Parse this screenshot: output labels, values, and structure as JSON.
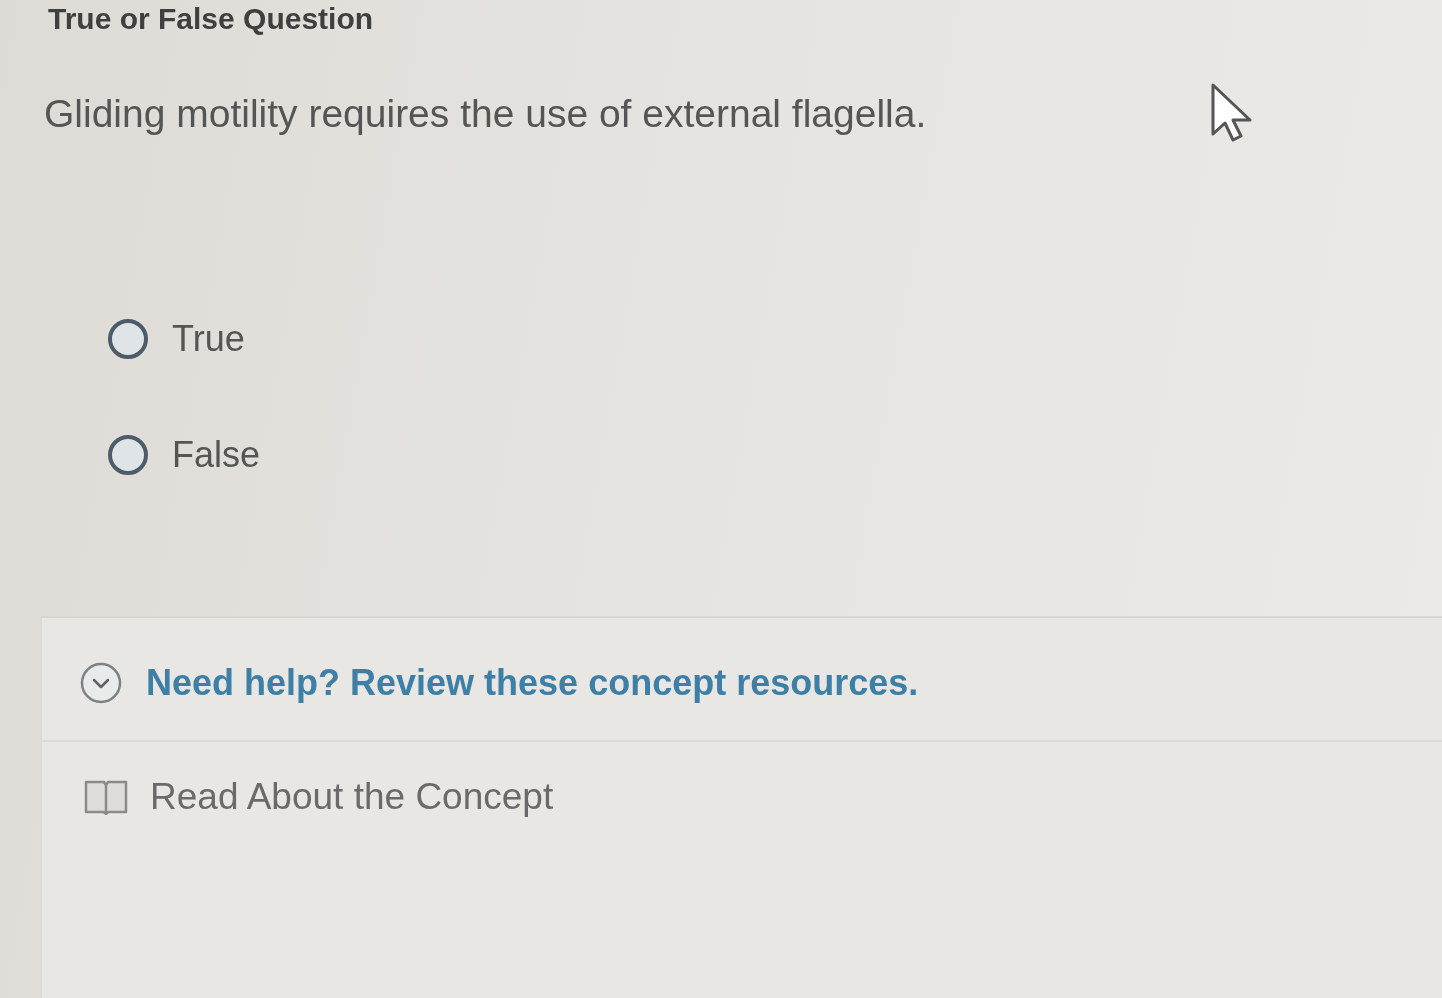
{
  "page": {
    "title": "True or False Question"
  },
  "question": {
    "text": "Gliding motility requires the use of external flagella."
  },
  "options": [
    {
      "label": "True",
      "selected": false
    },
    {
      "label": "False",
      "selected": false
    }
  ],
  "help": {
    "title": "Need help? Review these concept resources.",
    "resources": [
      {
        "label": "Read About the Concept"
      }
    ]
  }
}
